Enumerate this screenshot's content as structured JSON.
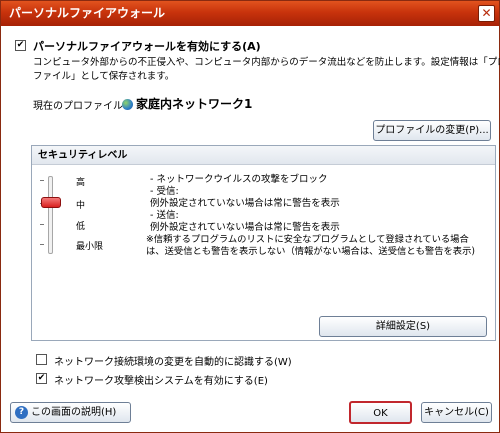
{
  "window": {
    "title": "パーソナルファイアウォール",
    "close_glyph": "✕"
  },
  "firewall": {
    "enable_label": "パーソナルファイアウォールを有効にする(A)",
    "enable_checked": true,
    "desc_line1": "コンピュータ外部からの不正侵入や、コンピュータ内部からのデータ流出などを防止します。設定情報は「プロ",
    "desc_line2": "ファイル」として保存されます。"
  },
  "profile": {
    "label": "現在のプロファイル:",
    "icon": "globe-icon",
    "name": "家庭内ネットワーク1",
    "change_button": "プロファイルの変更(P)..."
  },
  "security": {
    "header": "セキュリティレベル",
    "levels": [
      "高",
      "中",
      "低",
      "最小限"
    ],
    "current_level": "中",
    "description": [
      "- ネットワークウイルスの攻撃をブロック",
      "- 受信:",
      "  例外設定されていない場合は常に警告を表示",
      "- 送信:",
      "  例外設定されていない場合は常に警告を表示",
      "※信頼するプログラムのリストに安全なプログラムとして登録されている場合",
      "は、送受信とも警告を表示しない（情報がない場合は、送受信とも警告を表示)"
    ],
    "details_button": "詳細設定(S)"
  },
  "options": {
    "auto_detect_label": "ネットワーク接続環境の変更を自動的に認識する(W)",
    "auto_detect_checked": false,
    "attack_detect_label": "ネットワーク攻撃検出システムを有効にする(E)",
    "attack_detect_checked": true
  },
  "footer": {
    "help_icon": "help-icon",
    "help_glyph": "?",
    "help_button": "この画面の説明(H)",
    "ok_button": "OK",
    "cancel_button": "キャンセル(C)"
  },
  "colors": {
    "accent": "#c8330c",
    "slider_thumb": "#d8201f"
  }
}
